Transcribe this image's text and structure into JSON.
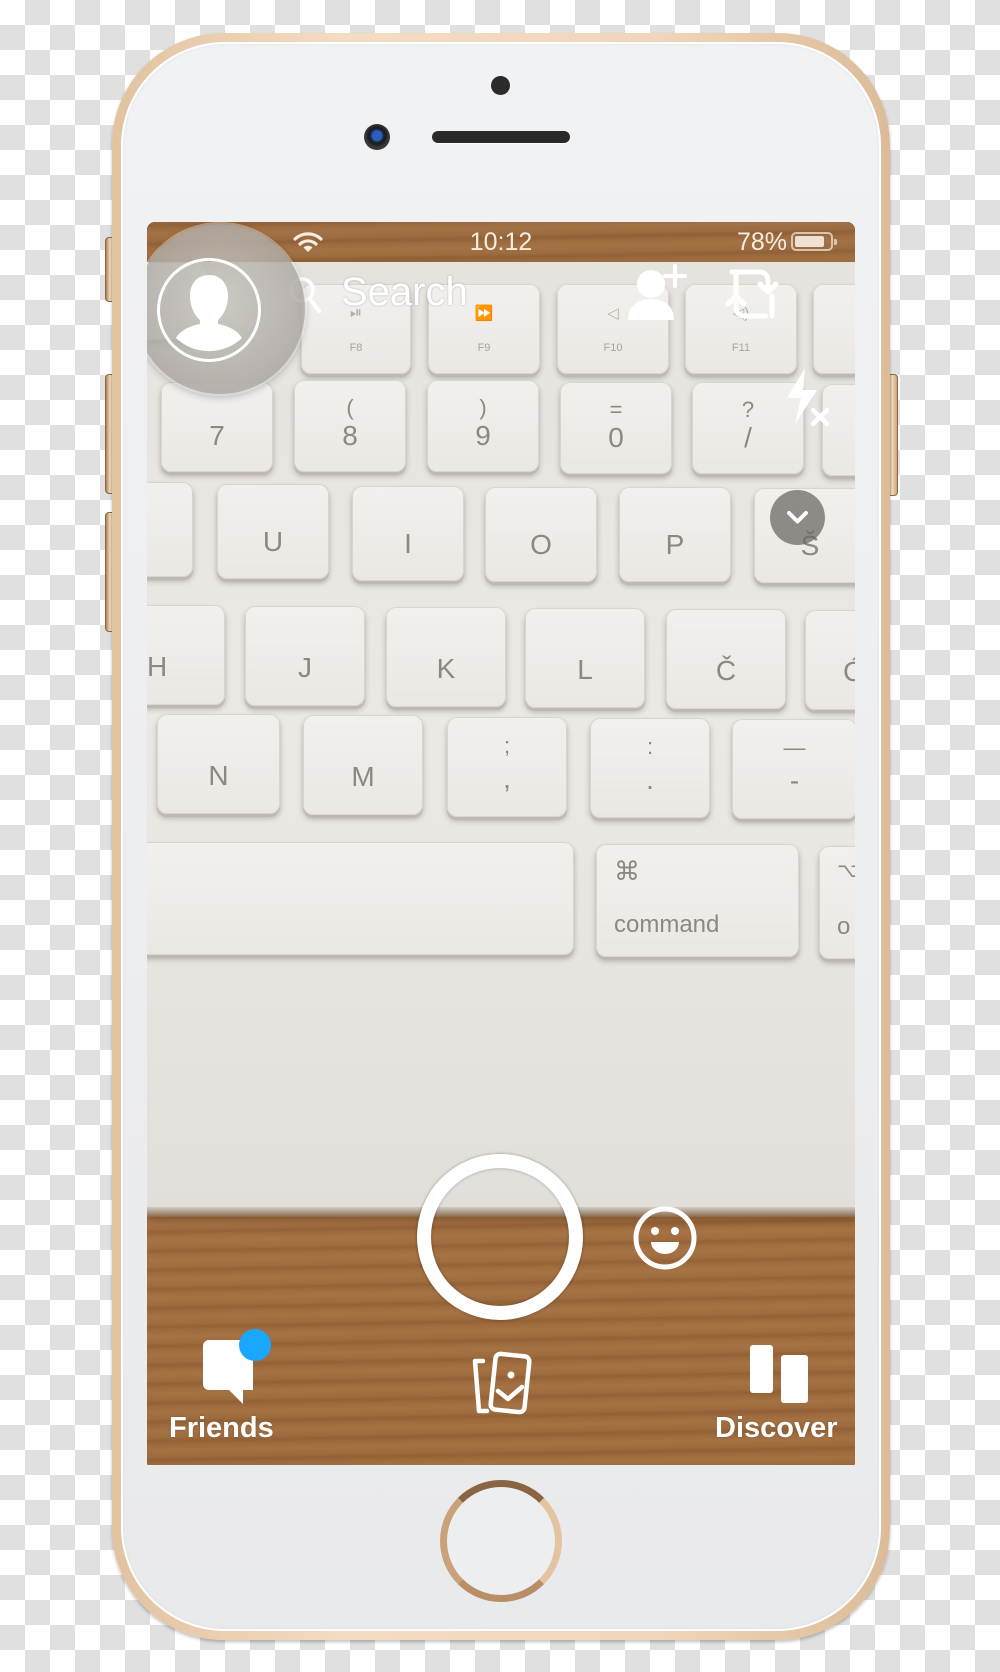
{
  "device": {
    "model": "iPhone",
    "frame_color": "#f0d6ba"
  },
  "status_bar": {
    "time": "10:12",
    "battery_percent": "78%",
    "battery_level": 0.78,
    "wifi": "wifi-icon"
  },
  "top_bar": {
    "search_label": "Search",
    "icons": [
      "avatar-icon",
      "search-icon",
      "add-friend-icon",
      "flip-camera-icon",
      "flash-off-icon",
      "chevron-down-icon"
    ]
  },
  "camera_view": {
    "keyboard_keys": {
      "fn_row": [
        {
          "symbol": "⏯",
          "fn": "F8"
        },
        {
          "symbol": "⏩",
          "fn": "F9"
        },
        {
          "symbol": "◁",
          "fn": "F10"
        },
        {
          "symbol": "◁)",
          "fn": "F11"
        }
      ],
      "number_row": [
        {
          "top": "",
          "main": "7"
        },
        {
          "top": "(",
          "main": "8"
        },
        {
          "top": ")",
          "main": "9"
        },
        {
          "top": "=",
          "main": "0"
        },
        {
          "top": "?",
          "main": "/"
        }
      ],
      "top_letter_row": [
        "U",
        "I",
        "O",
        "P",
        "Š"
      ],
      "home_row": [
        "H",
        "J",
        "K",
        "L",
        "Č",
        "Ć"
      ],
      "bottom_row": [
        {
          "top": "",
          "main": "N"
        },
        {
          "top": "",
          "main": "M"
        },
        {
          "top": ";",
          "main": ","
        },
        {
          "top": ":",
          "main": "."
        },
        {
          "top": "—",
          "main": "-"
        }
      ],
      "command_key": {
        "symbol": "⌘",
        "label": "command"
      },
      "option_key": {
        "symbol": "⌥",
        "label": "o"
      }
    }
  },
  "bottom_bar": {
    "friends_label": "Friends",
    "discover_label": "Discover",
    "memories_icon": "memories-icon",
    "notification_badge_color": "#1aa7ff"
  }
}
